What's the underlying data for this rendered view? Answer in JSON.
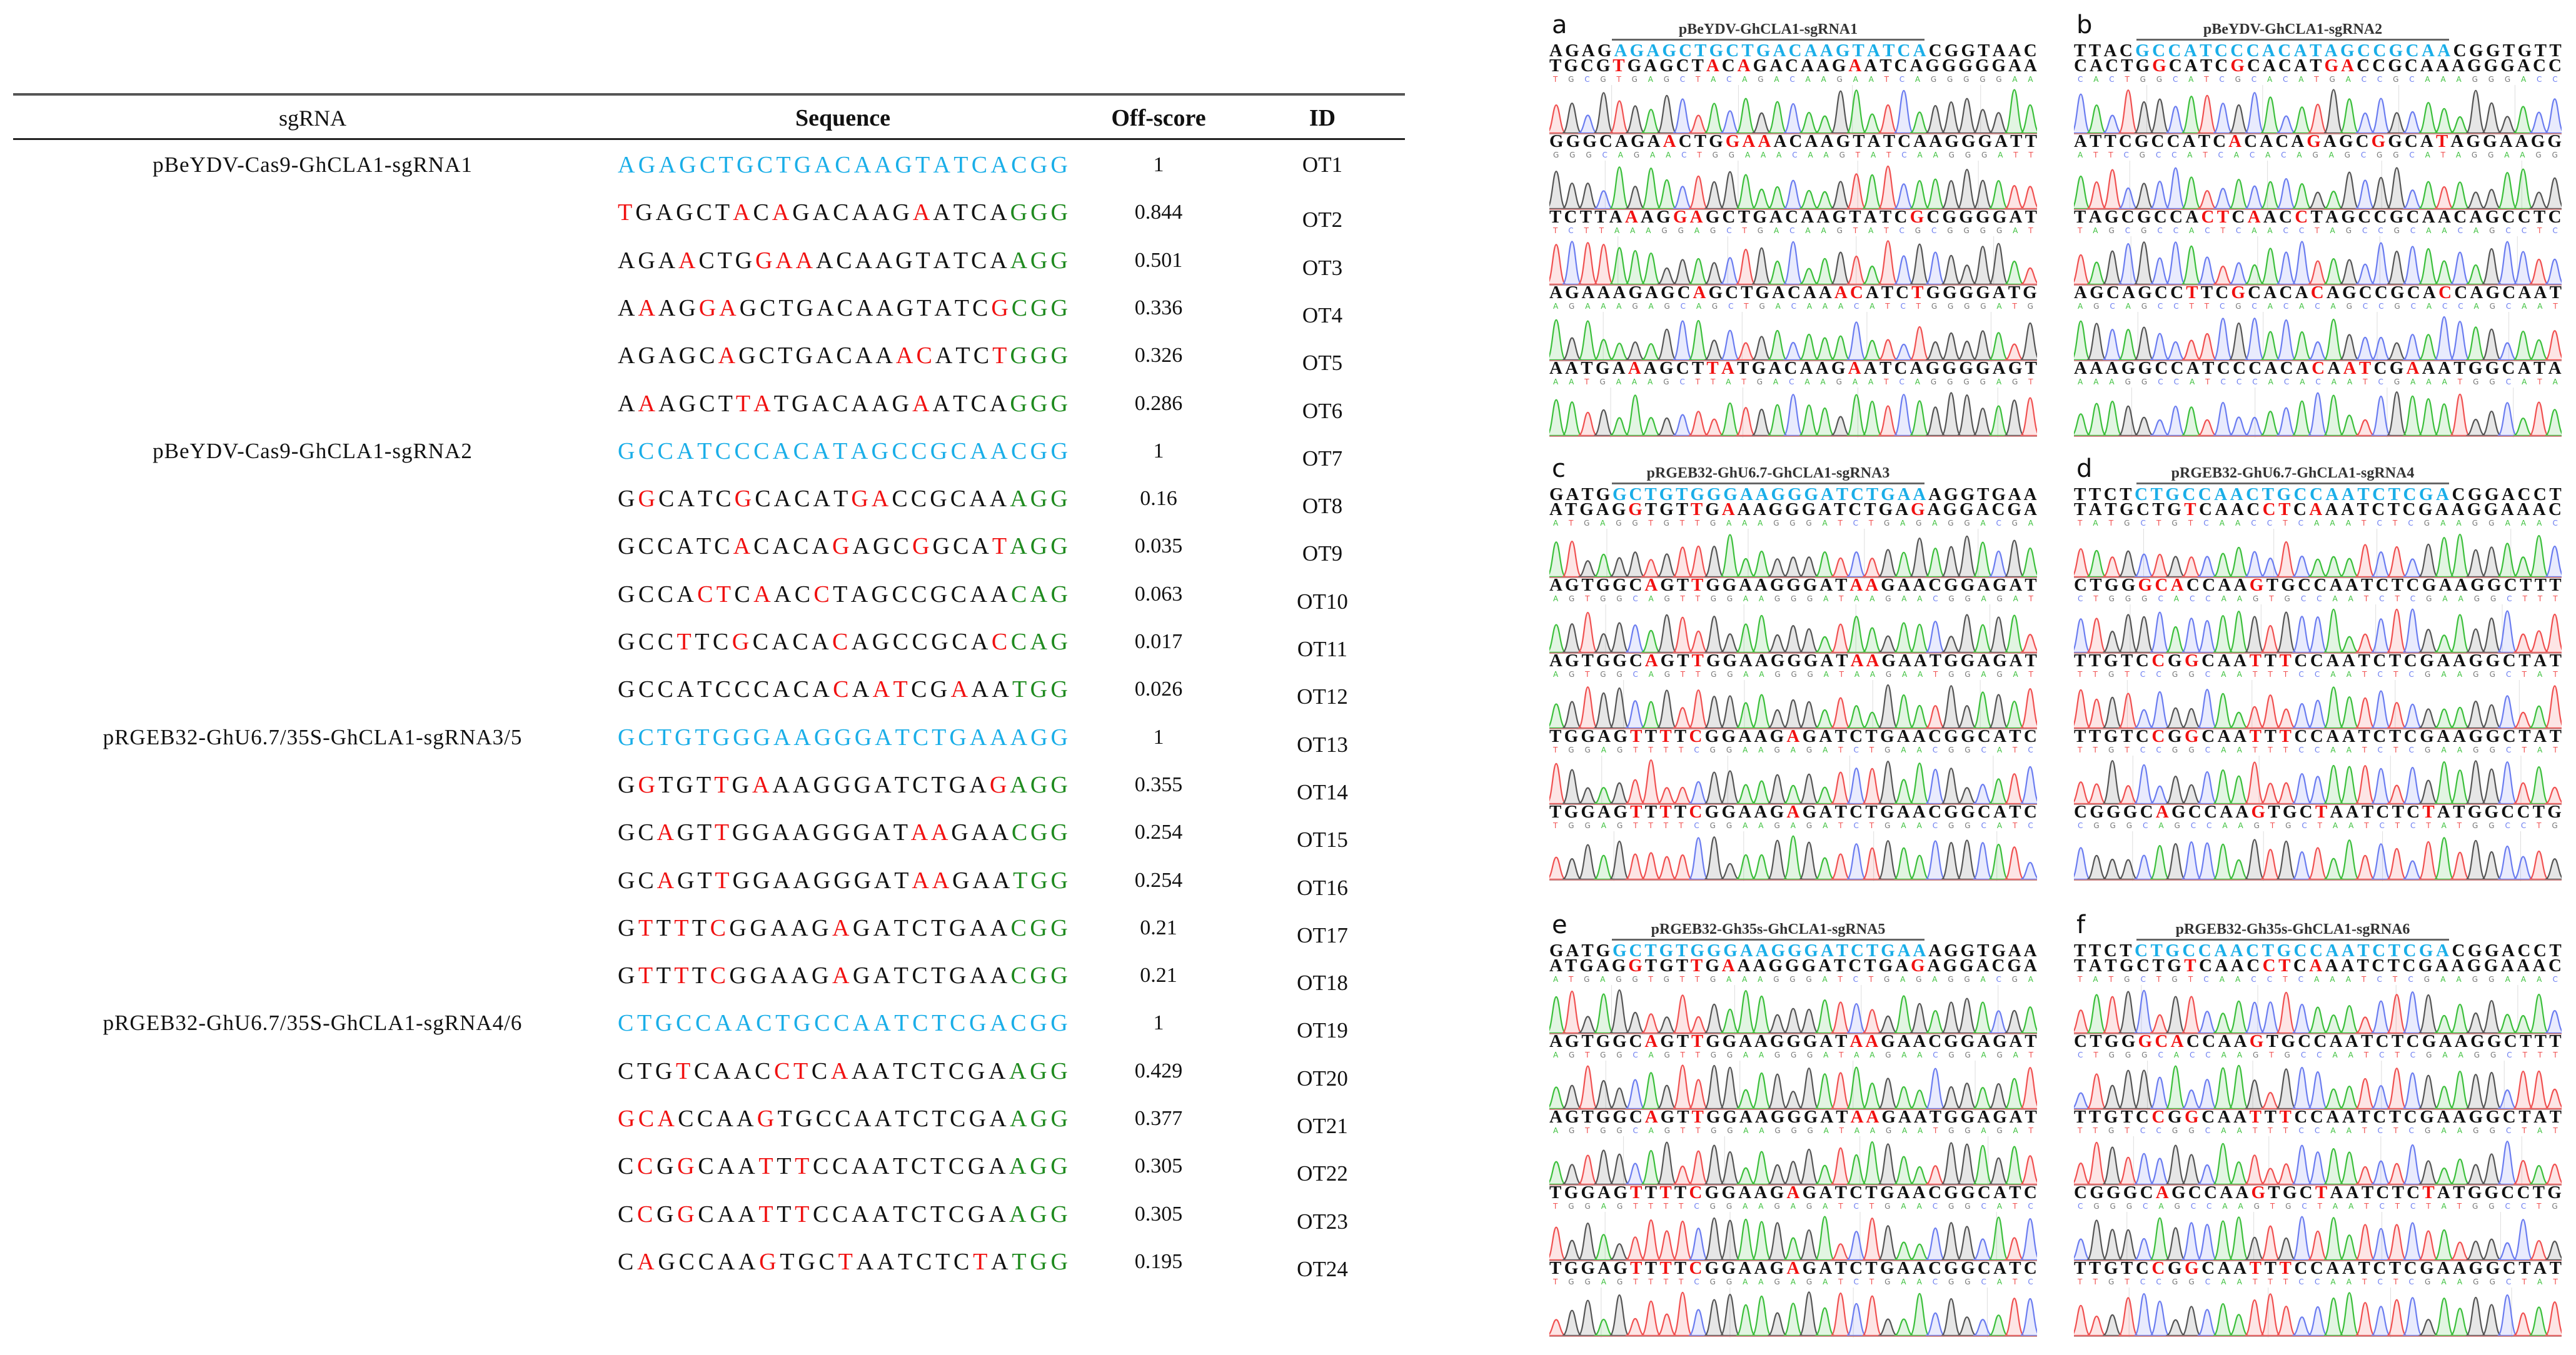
{
  "table": {
    "headers": {
      "sgrna": "sgRNA",
      "sequence": "Sequence",
      "off_score": "Off-score",
      "id": "ID"
    },
    "rows": [
      {
        "sgrna": "pBeYDV-Cas9-GhCLA1-sgRNA1",
        "sequence": "AGAGCTGCTGACAAGTATCACGG",
        "target": true,
        "off_score": "1",
        "id": "OT1"
      },
      {
        "sequence": "[T]GAGCT[A]C[A]GACAAG[A]ATCA{GGG}",
        "off_score": "0.844",
        "id": "OT2"
      },
      {
        "sequence": "AGA[A]CTG[GAA]ACAAGTATCA{AGG}",
        "off_score": "0.501",
        "id": "OT3"
      },
      {
        "sequence": "A[A]AG[GA]GCTGACAAGTATC[G]{CGG}",
        "off_score": "0.336",
        "id": "OT4"
      },
      {
        "sequence": "AGAGC[A]GCTGACAA[AC]ATC[T]{GGG}",
        "off_score": "0.326",
        "id": "OT5"
      },
      {
        "sequence": "A[A]AGCT[TA]TGACAAG[A]ATCA{GGG}",
        "off_score": "0.286",
        "id": "OT6"
      },
      {
        "sgrna": "pBeYDV-Cas9-GhCLA1-sgRNA2",
        "sequence": "GCCATCCCACATAGCCGCAACGG",
        "target": true,
        "off_score": "1",
        "id": "OT7"
      },
      {
        "sequence": "G[G]CATC[G]CACAT[GA]CCGCAA{AGG}",
        "off_score": "0.16",
        "id": "OT8"
      },
      {
        "sequence": "GCCATC[A]CACA[G]AGC[G]GCA[T]{AGG}",
        "off_score": "0.035",
        "id": "OT9"
      },
      {
        "sequence": "GCCA[CT]C[A]AC[C]TAGCCGCAA{CAG}",
        "off_score": "0.063",
        "id": "OT10"
      },
      {
        "sequence": "GCC[T]TC[G]CACA[C]AGCCGCA[C]{CAG}",
        "off_score": "0.017",
        "id": "OT11"
      },
      {
        "sequence": "GCCATCCCACA[C]A[AT]CG[A]AA{TGG}",
        "off_score": "0.026",
        "id": "OT12"
      },
      {
        "sgrna": "pRGEB32-GhU6.7/35S-GhCLA1-sgRNA3/5",
        "sequence": "GCTGTGGGAAGGGATCTGAAAGG",
        "target": true,
        "off_score": "1",
        "id": "OT13"
      },
      {
        "sequence": "G[G]TGT[T]G[A]AAGGGATCTGA[G]{AGG}",
        "off_score": "0.355",
        "id": "OT14"
      },
      {
        "sequence": "GC[A]GT[T]GGAAGGGAT[AA]GAA{CGG}",
        "off_score": "0.254",
        "id": "OT15"
      },
      {
        "sequence": "GC[A]GT[T]GGAAGGGAT[AA]GAA{TGG}",
        "off_score": "0.254",
        "id": "OT16"
      },
      {
        "sequence": "G[T]T[T]T[C]GGAAG[A]GATCTGAA{CGG}",
        "off_score": "0.21",
        "id": "OT17"
      },
      {
        "sequence": "G[T]T[T]T[C]GGAAG[A]GATCTGAA{CGG}",
        "off_score": "0.21",
        "id": "OT18"
      },
      {
        "sgrna": "pRGEB32-GhU6.7/35S-GhCLA1-sgRNA4/6",
        "sequence": "CTGCCAACTGCCAATCTCGACGG",
        "target": true,
        "off_score": "1",
        "id": "OT19"
      },
      {
        "sequence": "CTG[T]CAAC[CT]C[A]AATCTCGA{AGG}",
        "off_score": "0.429",
        "id": "OT20"
      },
      {
        "sequence": "[GCA]CCAA[G]TGCCAATCTCGA{AGG}",
        "off_score": "0.377",
        "id": "OT21"
      },
      {
        "sequence": "C[C]G[G]CAA[T]T[T]CCAATCTCGA{AGG}",
        "off_score": "0.305",
        "id": "OT22"
      },
      {
        "sequence": "C[C]G[G]CAA[T]T[T]CCAATCTCGA{AGG}",
        "off_score": "0.305",
        "id": "OT23"
      },
      {
        "sequence": "C[A]GCCAA[G]TGC[T]AATCTC[T]A{TGG}",
        "off_score": "0.195",
        "id": "OT24"
      }
    ]
  },
  "colors": {
    "target": "#1aaee8",
    "mismatch": "#f01010",
    "pam": "#1f8a1f",
    "A": "#3bbf3b",
    "C": "#6a7cf0",
    "G": "#555555",
    "T": "#f05050"
  },
  "panels": [
    {
      "label": "a",
      "title": "pBeYDV-GhCLA1-sgRNA1",
      "reference": {
        "left": "AGAG",
        "target": "AGAGCTGCTGACAAGTATCA",
        "right": "CGGTAAC"
      },
      "reads": [
        "TGCG[T]GAGCT[A]C[A]GACAAG[A]ATCAGGGGGAA",
        "GGGCAGA[A]CTG[GAA]ACAAGTATCAAGGGATT",
        "TCTTA[A]AG[GA]GCTGACAAGTATC[G]CGGGGAT",
        "AGAAAGAGC[A]GCTGACAA[AC]ATC[T]GGGGATG",
        "AATGA[A]AGCT[TA]TGACAAG[A]ATCAGGGGAGT"
      ]
    },
    {
      "label": "b",
      "title": "pBeYDV-GhCLA1-sgRNA2",
      "reference": {
        "left": "TTAC",
        "target": "GCCATCCCACATAGCCGCAA",
        "right": "CGGTGTT"
      },
      "reads": [
        "CACTG[G]CATC[G]CACAT[GA]CCGCAAAGGGACC",
        "ATTCGCCATC[A]CACA[G]AGC[G]GCA[T]AGGAAGG",
        "TAGCGCCA[CT]C[A]AC[C]TAGCCGCAACAGCCTC",
        "AGCAGCC[T]TC[G]CACA[C]AGCCGCA[C]CAGCAAT",
        "AAAGGCCATCCCACA[C]A[AT]CG[A]AATGGCATA"
      ]
    },
    {
      "label": "c",
      "title": "pRGEB32-GhU6.7-GhCLA1-sgRNA3",
      "reference": {
        "left": "GATG",
        "target": "GCTGTGGGAAGGGATCTGAA",
        "right": "AGGTGAA"
      },
      "reads": [
        "ATGAG[G]TGT[T]G[A]AAGGGATCTGA[G]AGGACGA",
        "AGTGGC[A]GT[T]GGAAGGGAT[AA]GAACGGAGAT",
        "AGTGGC[A]GT[T]GGAAGGGAT[AA]GAATGGAGAT",
        "TGGAG[T]T[T]T[C]GGAAG[A]GATCTGAACGGCATC",
        "TGGAG[T]T[T]T[C]GGAAG[A]GATCTGAACGGCATC"
      ]
    },
    {
      "label": "d",
      "title": "pRGEB32-GhU6.7-GhCLA1-sgRNA4",
      "reference": {
        "left": "TTCT",
        "target": "CTGCCAACTGCCAATCTCGA",
        "right": "CGGACCT"
      },
      "reads": [
        "TATGCTG[T]CAAC[CT]C[A]AATCTCGAAGGAAAC",
        "CTGG[GCA]CCAA[G]TGCCAATCTCGAAGGCTTT",
        "TTGTC[C]G[G]CAA[T]T[T]CCAATCTCGAAGGCTAT",
        "TTGTC[C]G[G]CAA[T]T[T]CCAATCTCGAAGGCTAT",
        "CGGGC[A]GCCAA[G]TGC[T]AATCTC[T]ATGGCCTG"
      ]
    },
    {
      "label": "e",
      "title": "pRGEB32-Gh35s-GhCLA1-sgRNA5",
      "reference": {
        "left": "GATG",
        "target": "GCTGTGGGAAGGGATCTGAA",
        "right": "AGGTGAA"
      },
      "reads": [
        "ATGAG[G]TGT[T]G[A]AAGGGATCTGA[G]AGGACGA",
        "AGTGGC[A]GT[T]GGAAGGGAT[AA]GAACGGAGAT",
        "AGTGGC[A]GT[T]GGAAGGGAT[AA]GAATGGAGAT",
        "TGGAG[T]T[T]T[C]GGAAG[A]GATCTGAACGGCATC",
        "TGGAG[T]T[T]T[C]GGAAG[A]GATCTGAACGGCATC"
      ]
    },
    {
      "label": "f",
      "title": "pRGEB32-Gh35s-GhCLA1-sgRNA6",
      "reference": {
        "left": "TTCT",
        "target": "CTGCCAACTGCCAATCTCGA",
        "right": "CGGACCT"
      },
      "reads": [
        "TATGCTG[T]CAAC[CT]C[A]AATCTCGAAGGAAAC",
        "CTGG[GCA]CCAA[G]TGCCAATCTCGAAGGCTTT",
        "TTGTC[C]G[G]CAA[T]T[T]CCAATCTCGAAGGCTAT",
        "CGGGC[A]GCCAA[G]TGC[T]AATCTC[T]ATGGCCTG",
        "TTGTC[C]G[G]CAA[T]T[T]CCAATCTCGAAGGCTAT"
      ]
    }
  ]
}
